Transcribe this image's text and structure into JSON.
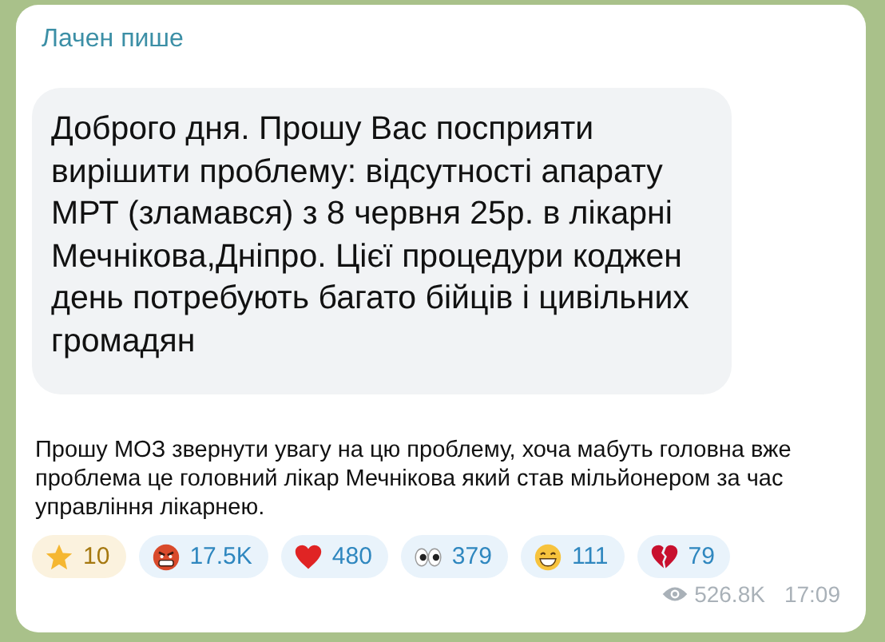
{
  "message": {
    "author": "Лачен пише",
    "quote": "Доброго дня. Прошу Вас посприяти вирішити проблему: відсутності апарату МРТ (зламався) з 8 червня 25р. в лікарні Мечнікова,Дніпро. Цієї процедури коджен день потребують багато бійців і цивільних громадян",
    "text": "Прошу МОЗ звернути увагу на цю проблему, хоча мабуть головна вже проблема це головний лікар Мечнікова який став мільйонером за час управління лікарнею.",
    "reactions": [
      {
        "kind": "star",
        "count": "10"
      },
      {
        "kind": "angry",
        "count": "17.5K"
      },
      {
        "kind": "heart",
        "count": "480"
      },
      {
        "kind": "eyes",
        "count": "379"
      },
      {
        "kind": "grin",
        "count": "111"
      },
      {
        "kind": "broken-heart",
        "count": "79"
      }
    ],
    "views": "526.8K",
    "time": "17:09"
  }
}
